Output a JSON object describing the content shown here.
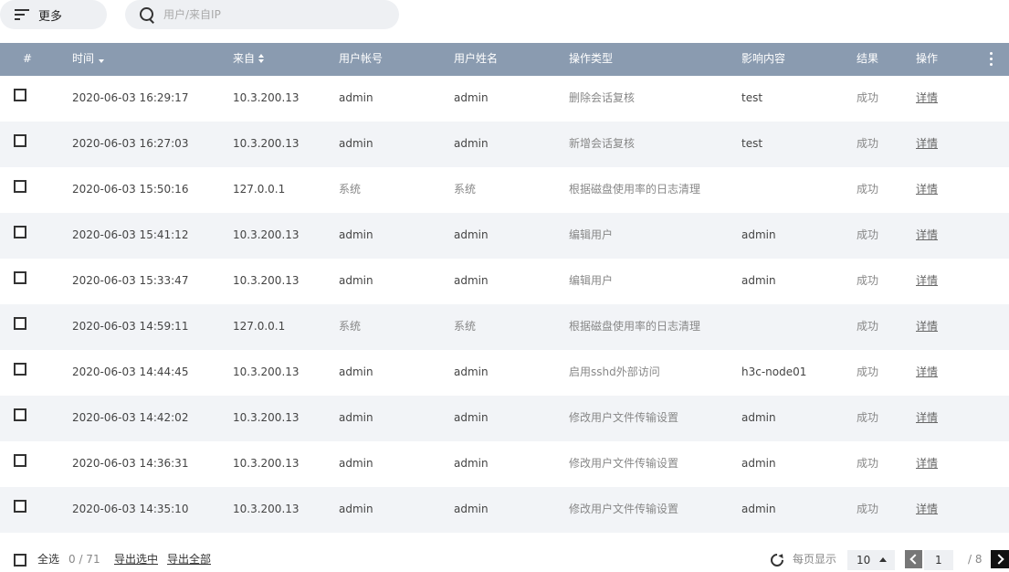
{
  "toolbar": {
    "more_label": "更多",
    "search_placeholder": "用户/来自IP"
  },
  "table": {
    "columns": {
      "index": "#",
      "time": "时间",
      "from": "来自",
      "account": "用户帐号",
      "username": "用户姓名",
      "op_type": "操作类型",
      "target": "影响内容",
      "result": "结果",
      "action": "操作"
    },
    "rows": [
      {
        "time": "2020-06-03 16:29:17",
        "from": "10.3.200.13",
        "account": "admin",
        "username": "admin",
        "op_type": "删除会话复核",
        "target": "test",
        "result": "成功",
        "action": "详情"
      },
      {
        "time": "2020-06-03 16:27:03",
        "from": "10.3.200.13",
        "account": "admin",
        "username": "admin",
        "op_type": "新增会话复核",
        "target": "test",
        "result": "成功",
        "action": "详情"
      },
      {
        "time": "2020-06-03 15:50:16",
        "from": "127.0.0.1",
        "account": "系统",
        "username": "系统",
        "op_type": "根据磁盘使用率的日志清理",
        "target": "",
        "result": "成功",
        "action": "详情"
      },
      {
        "time": "2020-06-03 15:41:12",
        "from": "10.3.200.13",
        "account": "admin",
        "username": "admin",
        "op_type": "编辑用户",
        "target": "admin",
        "result": "成功",
        "action": "详情"
      },
      {
        "time": "2020-06-03 15:33:47",
        "from": "10.3.200.13",
        "account": "admin",
        "username": "admin",
        "op_type": "编辑用户",
        "target": "admin",
        "result": "成功",
        "action": "详情"
      },
      {
        "time": "2020-06-03 14:59:11",
        "from": "127.0.0.1",
        "account": "系统",
        "username": "系统",
        "op_type": "根据磁盘使用率的日志清理",
        "target": "",
        "result": "成功",
        "action": "详情"
      },
      {
        "time": "2020-06-03 14:44:45",
        "from": "10.3.200.13",
        "account": "admin",
        "username": "admin",
        "op_type": "启用sshd外部访问",
        "target": "h3c-node01",
        "result": "成功",
        "action": "详情"
      },
      {
        "time": "2020-06-03 14:42:02",
        "from": "10.3.200.13",
        "account": "admin",
        "username": "admin",
        "op_type": "修改用户文件传输设置",
        "target": "admin",
        "result": "成功",
        "action": "详情"
      },
      {
        "time": "2020-06-03 14:36:31",
        "from": "10.3.200.13",
        "account": "admin",
        "username": "admin",
        "op_type": "修改用户文件传输设置",
        "target": "admin",
        "result": "成功",
        "action": "详情"
      },
      {
        "time": "2020-06-03 14:35:10",
        "from": "10.3.200.13",
        "account": "admin",
        "username": "admin",
        "op_type": "修改用户文件传输设置",
        "target": "admin",
        "result": "成功",
        "action": "详情"
      }
    ]
  },
  "footer": {
    "select_all": "全选",
    "selected_count": "0 / 71",
    "export_selected": "导出选中",
    "export_all": "导出全部",
    "per_page_label": "每页显示",
    "per_page_value": "10",
    "current_page": "1",
    "total_pages": "/ 8"
  }
}
